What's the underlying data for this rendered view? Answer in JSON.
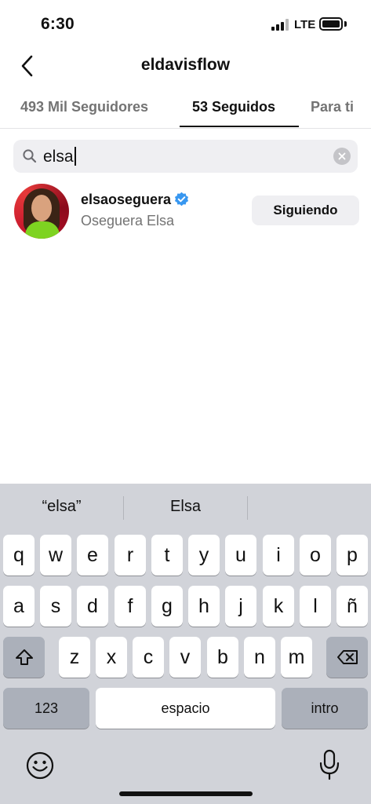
{
  "status_bar": {
    "time": "6:30",
    "network": "LTE"
  },
  "header": {
    "title": "eldavisflow",
    "back_icon": "chevron-left-icon"
  },
  "tabs": [
    {
      "label": "493 Mil Seguidores",
      "active": false
    },
    {
      "label": "53 Seguidos",
      "active": true
    },
    {
      "label": "Para ti",
      "active": false
    }
  ],
  "search": {
    "value": "elsa",
    "icon": "search-icon"
  },
  "result": {
    "username": "elsaoseguera",
    "full_name": "Oseguera Elsa",
    "verified": true,
    "button_label": "Siguiendo"
  },
  "keyboard": {
    "suggestions": [
      "“elsa”",
      "Elsa",
      ""
    ],
    "row1": [
      "q",
      "w",
      "e",
      "r",
      "t",
      "y",
      "u",
      "i",
      "o",
      "p"
    ],
    "row2": [
      "a",
      "s",
      "d",
      "f",
      "g",
      "h",
      "j",
      "k",
      "l",
      "ñ"
    ],
    "row3": [
      "z",
      "x",
      "c",
      "v",
      "b",
      "n",
      "m"
    ],
    "numbers_label": "123",
    "space_label": "espacio",
    "return_label": "intro"
  },
  "colors": {
    "verified": "#3897f0",
    "keyboard_bg": "#d1d3d9",
    "secondary_text": "#737373"
  }
}
